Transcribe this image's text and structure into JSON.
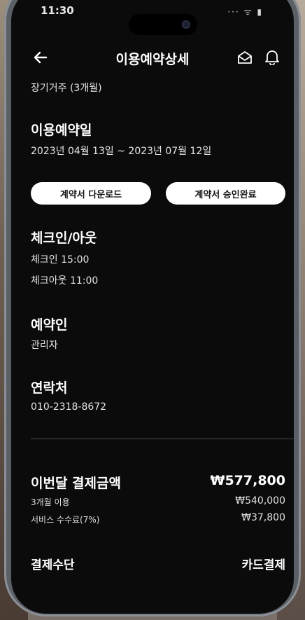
{
  "status_bar": {
    "time": "11:30",
    "signal": "··· ᯤ ▮"
  },
  "header": {
    "title": "이용예약상세"
  },
  "stay": {
    "type": "장기거주 (3개월)"
  },
  "reservation_date": {
    "heading": "이용예약일",
    "range": "2023년 04월 13일 ~ 2023년 07월 12일"
  },
  "buttons": {
    "download": "계약서 다운로드",
    "approval": "계약서 승인완료"
  },
  "checkin": {
    "heading": "체크인/아웃",
    "in": "체크인 15:00",
    "out": "체크아웃 11:00"
  },
  "reserver": {
    "heading": "예약인",
    "name": "관리자"
  },
  "contact": {
    "heading": "연락처",
    "phone": "010-2318-8672"
  },
  "payment": {
    "heading": "이번달 결제금액",
    "total": "₩577,800",
    "line1_label": "3개월 이용",
    "line1_value": "₩540,000",
    "line2_label": "서비스 수수료(7%)",
    "line2_value": "₩37,800",
    "method_label": "결제수단",
    "method_value": "카드결제"
  }
}
